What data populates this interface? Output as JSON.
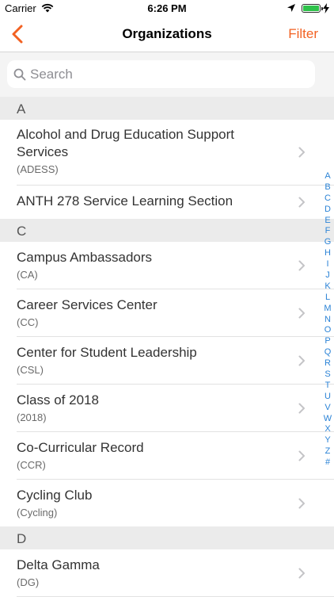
{
  "status_bar": {
    "carrier": "Carrier",
    "time": "6:26 PM"
  },
  "nav": {
    "title": "Organizations",
    "filter_label": "Filter"
  },
  "search": {
    "placeholder": "Search"
  },
  "colors": {
    "accent": "#f26122",
    "index": "#2b83d6"
  },
  "sections": [
    {
      "letter": "A",
      "items": [
        {
          "name": "Alcohol and Drug Education Support Services",
          "abbr": "(ADESS)"
        },
        {
          "name": "ANTH 278 Service Learning Section",
          "abbr": ""
        }
      ]
    },
    {
      "letter": "C",
      "items": [
        {
          "name": "Campus Ambassadors",
          "abbr": "(CA)"
        },
        {
          "name": "Career Services Center",
          "abbr": "(CC)"
        },
        {
          "name": "Center for Student Leadership",
          "abbr": "(CSL)"
        },
        {
          "name": "Class of 2018",
          "abbr": "(2018)"
        },
        {
          "name": "Co-Curricular Record",
          "abbr": "(CCR)"
        },
        {
          "name": "Cycling Club",
          "abbr": "(Cycling)"
        }
      ]
    },
    {
      "letter": "D",
      "items": [
        {
          "name": "Delta Gamma",
          "abbr": "(DG)"
        }
      ]
    }
  ],
  "index_letters": [
    "A",
    "B",
    "C",
    "D",
    "E",
    "F",
    "G",
    "H",
    "I",
    "J",
    "K",
    "L",
    "M",
    "N",
    "O",
    "P",
    "Q",
    "R",
    "S",
    "T",
    "U",
    "V",
    "W",
    "X",
    "Y",
    "Z",
    "#"
  ]
}
